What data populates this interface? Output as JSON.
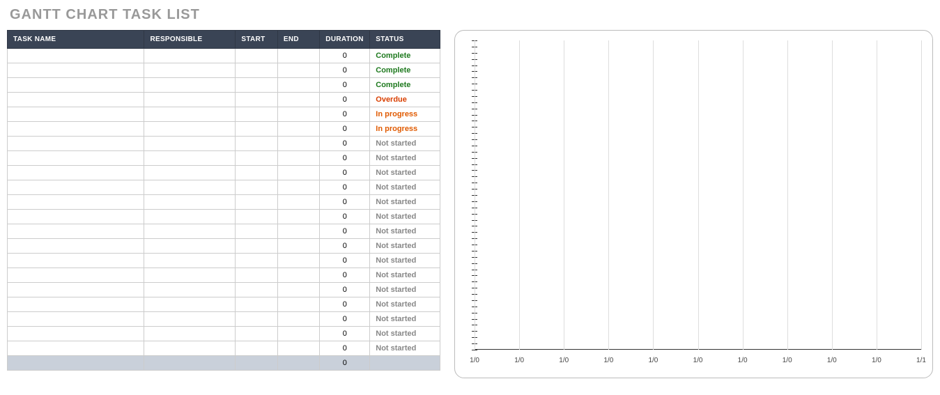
{
  "title": "GANTT CHART TASK LIST",
  "headers": {
    "task": "TASK NAME",
    "responsible": "RESPONSIBLE",
    "start": "START",
    "end": "END",
    "duration": "DURATION",
    "status": "STATUS"
  },
  "rows": [
    {
      "task": "",
      "responsible": "",
      "start": "",
      "end": "",
      "duration": "0",
      "status": "Complete",
      "cls": "st-complete"
    },
    {
      "task": "",
      "responsible": "",
      "start": "",
      "end": "",
      "duration": "0",
      "status": "Complete",
      "cls": "st-complete"
    },
    {
      "task": "",
      "responsible": "",
      "start": "",
      "end": "",
      "duration": "0",
      "status": "Complete",
      "cls": "st-complete"
    },
    {
      "task": "",
      "responsible": "",
      "start": "",
      "end": "",
      "duration": "0",
      "status": "Overdue",
      "cls": "st-overdue"
    },
    {
      "task": "",
      "responsible": "",
      "start": "",
      "end": "",
      "duration": "0",
      "status": "In progress",
      "cls": "st-progress"
    },
    {
      "task": "",
      "responsible": "",
      "start": "",
      "end": "",
      "duration": "0",
      "status": "In progress",
      "cls": "st-progress"
    },
    {
      "task": "",
      "responsible": "",
      "start": "",
      "end": "",
      "duration": "0",
      "status": "Not started",
      "cls": "st-notstarted"
    },
    {
      "task": "",
      "responsible": "",
      "start": "",
      "end": "",
      "duration": "0",
      "status": "Not started",
      "cls": "st-notstarted"
    },
    {
      "task": "",
      "responsible": "",
      "start": "",
      "end": "",
      "duration": "0",
      "status": "Not started",
      "cls": "st-notstarted"
    },
    {
      "task": "",
      "responsible": "",
      "start": "",
      "end": "",
      "duration": "0",
      "status": "Not started",
      "cls": "st-notstarted"
    },
    {
      "task": "",
      "responsible": "",
      "start": "",
      "end": "",
      "duration": "0",
      "status": "Not started",
      "cls": "st-notstarted"
    },
    {
      "task": "",
      "responsible": "",
      "start": "",
      "end": "",
      "duration": "0",
      "status": "Not started",
      "cls": "st-notstarted"
    },
    {
      "task": "",
      "responsible": "",
      "start": "",
      "end": "",
      "duration": "0",
      "status": "Not started",
      "cls": "st-notstarted"
    },
    {
      "task": "",
      "responsible": "",
      "start": "",
      "end": "",
      "duration": "0",
      "status": "Not started",
      "cls": "st-notstarted"
    },
    {
      "task": "",
      "responsible": "",
      "start": "",
      "end": "",
      "duration": "0",
      "status": "Not started",
      "cls": "st-notstarted"
    },
    {
      "task": "",
      "responsible": "",
      "start": "",
      "end": "",
      "duration": "0",
      "status": "Not started",
      "cls": "st-notstarted"
    },
    {
      "task": "",
      "responsible": "",
      "start": "",
      "end": "",
      "duration": "0",
      "status": "Not started",
      "cls": "st-notstarted"
    },
    {
      "task": "",
      "responsible": "",
      "start": "",
      "end": "",
      "duration": "0",
      "status": "Not started",
      "cls": "st-notstarted"
    },
    {
      "task": "",
      "responsible": "",
      "start": "",
      "end": "",
      "duration": "0",
      "status": "Not started",
      "cls": "st-notstarted"
    },
    {
      "task": "",
      "responsible": "",
      "start": "",
      "end": "",
      "duration": "0",
      "status": "Not started",
      "cls": "st-notstarted"
    },
    {
      "task": "",
      "responsible": "",
      "start": "",
      "end": "",
      "duration": "0",
      "status": "Not started",
      "cls": "st-notstarted"
    }
  ],
  "totals": {
    "duration": "0"
  },
  "chart_data": {
    "type": "bar",
    "categories": [
      "1/0",
      "1/0",
      "1/0",
      "1/0",
      "1/0",
      "1/0",
      "1/0",
      "1/0",
      "1/0",
      "1/0",
      "1/1"
    ],
    "values": [],
    "title": "",
    "xlabel": "",
    "ylabel": "",
    "y_tick_count": 50,
    "x_tick_count": 11
  }
}
